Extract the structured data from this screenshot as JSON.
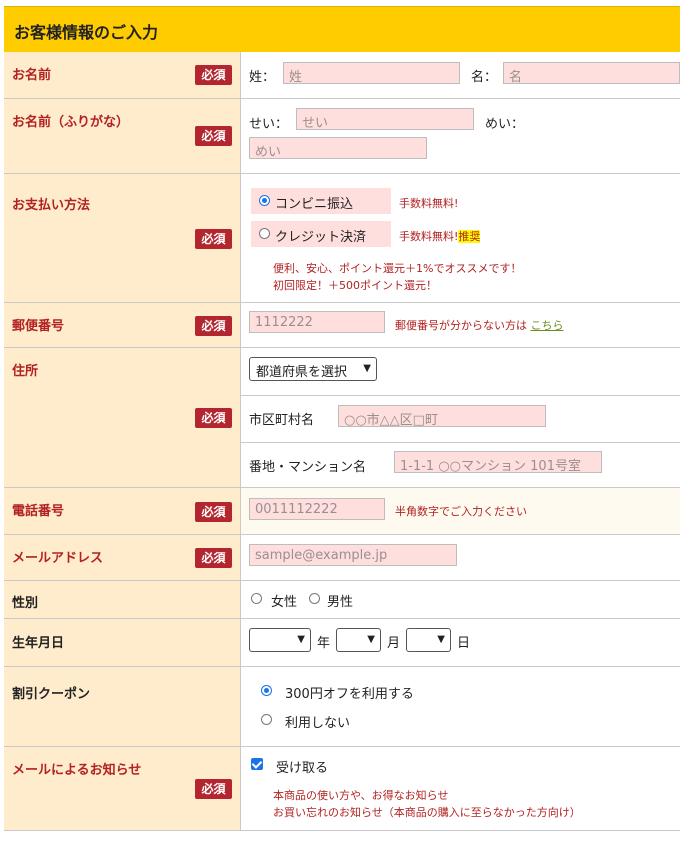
{
  "header": {
    "title": "お客様情報のご入力"
  },
  "required_badge": "必須",
  "name": {
    "label": "お名前",
    "sei_label": "姓：",
    "sei_placeholder": "姓",
    "mei_label": "名：",
    "mei_placeholder": "名"
  },
  "kana": {
    "label": "お名前（ふりがな）",
    "sei_label": "せい：",
    "sei_placeholder": "せい",
    "mei_label": "めい：",
    "mei_placeholder": "めい"
  },
  "payment": {
    "label": "お支払い方法",
    "options": [
      {
        "label": "コンビニ振込",
        "note": "手数料無料!",
        "selected": true
      },
      {
        "label": "クレジット決済",
        "note": "手数料無料!",
        "badge": "推奨",
        "selected": false
      }
    ],
    "promo_line1": "便利、安心、ポイント還元＋1%でオススメです！",
    "promo_line2": "初回限定！＋500ポイント還元！"
  },
  "postal": {
    "label": "郵便番号",
    "placeholder": "1112222",
    "help_text": "郵便番号が分からない方は",
    "help_link": "こちら"
  },
  "address": {
    "label": "住所",
    "prefecture_select": "都道府県を選択",
    "city_label": "市区町村名",
    "city_placeholder": "○○市△△区□町",
    "street_label": "番地・マンション名",
    "street_placeholder": "1-1-1 ○○マンション 101号室"
  },
  "phone": {
    "label": "電話番号",
    "placeholder": "0011112222",
    "note": "半角数字でご入力ください"
  },
  "email": {
    "label": "メールアドレス",
    "placeholder": "sample@example.jp"
  },
  "gender": {
    "label": "性別",
    "options": [
      "女性",
      "男性"
    ]
  },
  "birthday": {
    "label": "生年月日",
    "year": "年",
    "month": "月",
    "day": "日"
  },
  "coupon": {
    "label": "割引クーポン",
    "options": [
      {
        "label": "300円オフを利用する",
        "selected": true
      },
      {
        "label": "利用しない",
        "selected": false
      }
    ]
  },
  "newsletter": {
    "label": "メールによるお知らせ",
    "checkbox_label": "受け取る",
    "checked": true,
    "desc_line1": "本商品の使い方や、お得なお知らせ",
    "desc_line2": "お買い忘れのお知らせ（本商品の購入に至らなかった方向け）"
  },
  "colors": {
    "header_bg": "#ffcc00",
    "label_bg": "#ffeccc",
    "badge_bg": "#b32630",
    "input_bg": "#ffdede",
    "accent_text": "#b22222",
    "radio_blue": "#1a73e8"
  }
}
